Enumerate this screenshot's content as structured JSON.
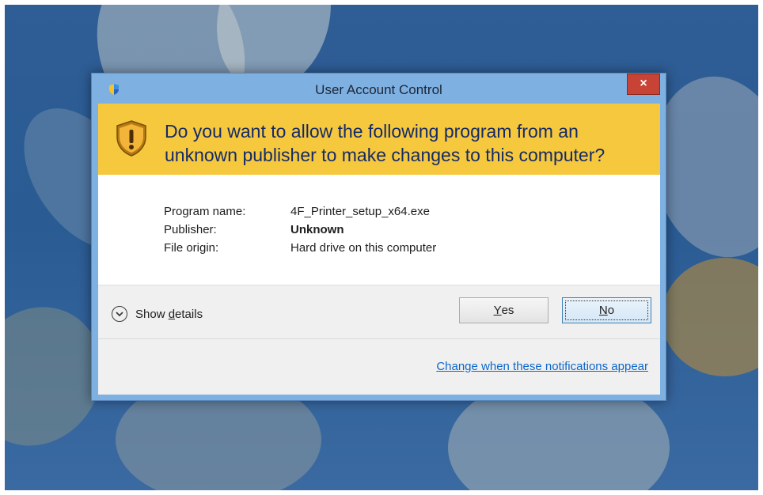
{
  "window": {
    "title": "User Account Control",
    "close_label": "×"
  },
  "banner": {
    "question": "Do you want to allow the following program from an unknown publisher to make changes to this computer?"
  },
  "info": {
    "rows": [
      {
        "label": "Program name:",
        "value": "4F_Printer_setup_x64.exe"
      },
      {
        "label": "Publisher:",
        "value": "Unknown"
      },
      {
        "label": "File origin:",
        "value": "Hard drive on this computer"
      }
    ]
  },
  "footer": {
    "details_prefix": "Show ",
    "details_underlined": "d",
    "details_suffix": "etails",
    "yes_underlined": "Y",
    "yes_rest": "es",
    "no_underlined": "N",
    "no_rest": "o",
    "link_text": "Change when these notifications appear"
  },
  "icons": {
    "title_icon": "uac-shield-icon",
    "banner_icon": "warning-shield-icon",
    "details_icon": "chevron-down-icon"
  },
  "colors": {
    "banner": "#f6c83e",
    "frame": "#7fb0e2",
    "close": "#c74335",
    "link": "#0d66c9"
  }
}
